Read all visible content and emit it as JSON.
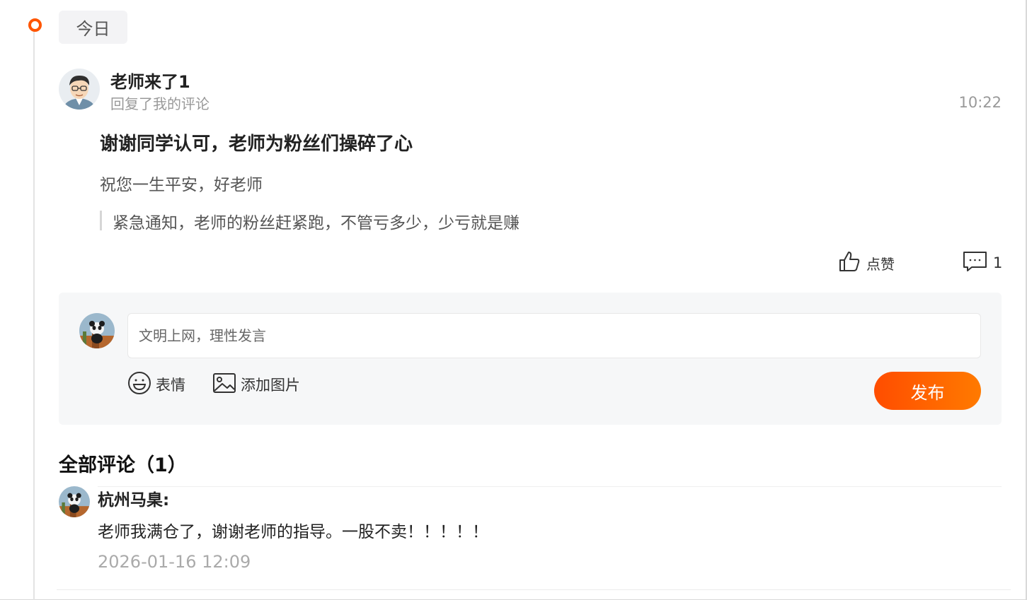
{
  "timeline": {
    "date_label": "今日"
  },
  "notification": {
    "author_name": "老师来了1",
    "action": "回复了我的评论",
    "time": "10:22",
    "reply_text": "谢谢同学认可，老师为粉丝们操碎了心",
    "my_comment": "祝您一生平安，好老师",
    "quoted_text": "紧急通知，老师的粉丝赶紧跑，不管亏多少，少亏就是赚",
    "like_label": "点赞",
    "comment_count": "1"
  },
  "reply_box": {
    "placeholder": "文明上网，理性发言",
    "emoji_label": "表情",
    "image_label": "添加图片",
    "publish_label": "发布"
  },
  "comments": {
    "title": "全部评论（1）",
    "items": [
      {
        "user": "杭州马臬:",
        "text": "老师我满仓了，谢谢老师的指导。一股不卖！！！！！",
        "date": "2026-01-16 12:09"
      }
    ]
  },
  "colors": {
    "accent": "#ff5500",
    "button_gradient_start": "#ff4d00",
    "button_gradient_end": "#ff7a00"
  },
  "icons": {
    "like": "thumbs-up-icon",
    "comment": "comment-bubble-icon",
    "emoji": "smile-icon",
    "image": "image-icon"
  }
}
